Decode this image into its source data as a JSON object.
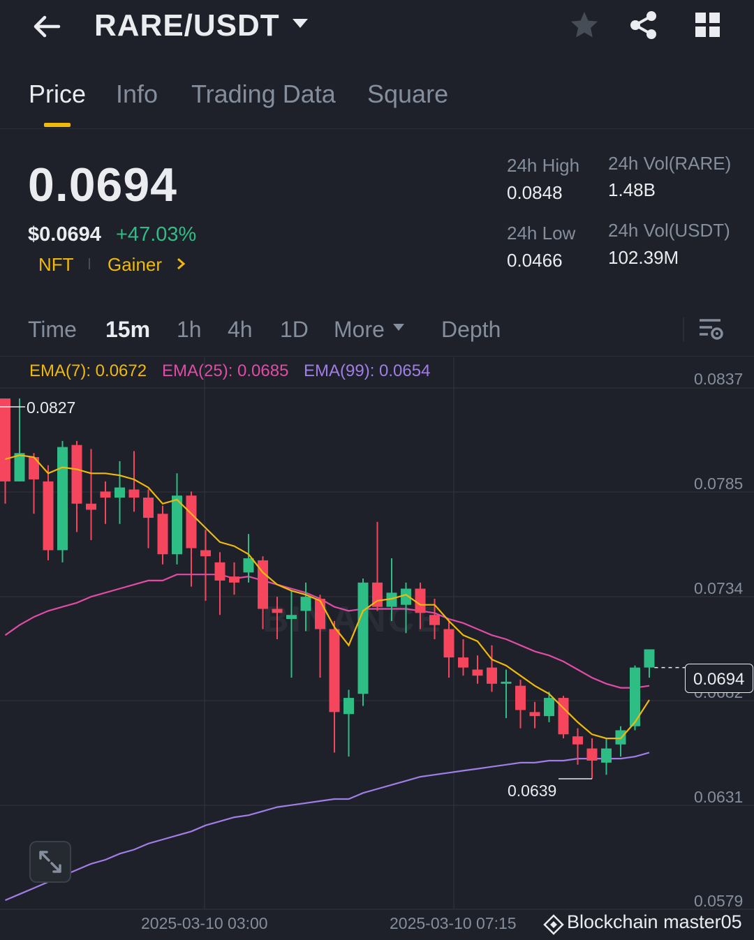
{
  "header": {
    "pair": "RARE/USDT"
  },
  "tabs": [
    {
      "label": "Price",
      "active": true
    },
    {
      "label": "Info",
      "active": false
    },
    {
      "label": "Trading Data",
      "active": false
    },
    {
      "label": "Square",
      "active": false
    }
  ],
  "ticker": {
    "price": "0.0694",
    "usd_price": "$0.0694",
    "change": "+47.03%",
    "tag_category": "NFT",
    "tag_gainer": "Gainer"
  },
  "stats": {
    "high_label": "24h High",
    "high_value": "0.0848",
    "low_label": "24h Low",
    "low_value": "0.0466",
    "vol_base_label": "24h Vol(RARE)",
    "vol_base_value": "1.48B",
    "vol_quote_label": "24h Vol(USDT)",
    "vol_quote_value": "102.39M"
  },
  "intervals": {
    "time": "Time",
    "m15": "15m",
    "h1": "1h",
    "h4": "4h",
    "d1": "1D",
    "more": "More",
    "depth": "Depth",
    "active": "15m"
  },
  "indicators": {
    "ema7": "EMA(7): 0.0672",
    "ema25": "EMA(25): 0.0685",
    "ema99": "EMA(99): 0.0654"
  },
  "colors": {
    "up": "#2ebd85",
    "down": "#f6465d",
    "ema7": "#f0b90b",
    "ema25": "#e04ca6",
    "ema99": "#a07ee6"
  },
  "chart": {
    "watermark": "BINANCE",
    "price_axis": [
      "0.0837",
      "0.0785",
      "0.0734",
      "0.0682",
      "0.0631",
      "0.0579"
    ],
    "time_axis": [
      "2025-03-10 03:00",
      "2025-03-10 07:15"
    ],
    "high_marker": "0.0827",
    "low_marker": "0.0639",
    "last_price": "0.0694",
    "expand_label": "expand"
  },
  "chart_data": {
    "type": "candlestick",
    "interval": "15m",
    "ylim": [
      0.0579,
      0.0837
    ],
    "x_ticks": [
      "2025-03-10 03:00",
      "2025-03-10 07:15"
    ],
    "candles": [
      {
        "o": 0.0827,
        "h": 0.0827,
        "l": 0.0775,
        "c": 0.0786
      },
      {
        "o": 0.0786,
        "h": 0.0827,
        "l": 0.0786,
        "c": 0.08
      },
      {
        "o": 0.0798,
        "h": 0.08,
        "l": 0.077,
        "c": 0.0787
      },
      {
        "o": 0.0786,
        "h": 0.0794,
        "l": 0.0747,
        "c": 0.0752
      },
      {
        "o": 0.0752,
        "h": 0.0806,
        "l": 0.0746,
        "c": 0.0803
      },
      {
        "o": 0.0804,
        "h": 0.0806,
        "l": 0.0761,
        "c": 0.0775
      },
      {
        "o": 0.0775,
        "h": 0.0802,
        "l": 0.0757,
        "c": 0.0772
      },
      {
        "o": 0.0781,
        "h": 0.0786,
        "l": 0.0765,
        "c": 0.0778
      },
      {
        "o": 0.0778,
        "h": 0.0796,
        "l": 0.0765,
        "c": 0.0783
      },
      {
        "o": 0.0782,
        "h": 0.0801,
        "l": 0.0771,
        "c": 0.0778
      },
      {
        "o": 0.0778,
        "h": 0.0782,
        "l": 0.0753,
        "c": 0.0768
      },
      {
        "o": 0.077,
        "h": 0.0774,
        "l": 0.0745,
        "c": 0.075
      },
      {
        "o": 0.075,
        "h": 0.079,
        "l": 0.0745,
        "c": 0.0779
      },
      {
        "o": 0.0779,
        "h": 0.0781,
        "l": 0.0734,
        "c": 0.0753
      },
      {
        "o": 0.0752,
        "h": 0.0762,
        "l": 0.0727,
        "c": 0.0749
      },
      {
        "o": 0.0746,
        "h": 0.0751,
        "l": 0.072,
        "c": 0.0737
      },
      {
        "o": 0.0739,
        "h": 0.0746,
        "l": 0.073,
        "c": 0.0736
      },
      {
        "o": 0.0741,
        "h": 0.076,
        "l": 0.0736,
        "c": 0.0748
      },
      {
        "o": 0.0747,
        "h": 0.0749,
        "l": 0.0713,
        "c": 0.0723
      },
      {
        "o": 0.0723,
        "h": 0.0729,
        "l": 0.0708,
        "c": 0.0721
      },
      {
        "o": 0.0718,
        "h": 0.0732,
        "l": 0.0689,
        "c": 0.072
      },
      {
        "o": 0.0722,
        "h": 0.0736,
        "l": 0.0712,
        "c": 0.0729
      },
      {
        "o": 0.0728,
        "h": 0.073,
        "l": 0.0689,
        "c": 0.0713
      },
      {
        "o": 0.0713,
        "h": 0.0717,
        "l": 0.0652,
        "c": 0.0672
      },
      {
        "o": 0.0671,
        "h": 0.0683,
        "l": 0.065,
        "c": 0.0679
      },
      {
        "o": 0.0681,
        "h": 0.0738,
        "l": 0.0675,
        "c": 0.0736
      },
      {
        "o": 0.0736,
        "h": 0.0766,
        "l": 0.0722,
        "c": 0.0724
      },
      {
        "o": 0.0724,
        "h": 0.0748,
        "l": 0.0717,
        "c": 0.0731
      },
      {
        "o": 0.0725,
        "h": 0.0736,
        "l": 0.0711,
        "c": 0.0733
      },
      {
        "o": 0.0733,
        "h": 0.0736,
        "l": 0.0713,
        "c": 0.0721
      },
      {
        "o": 0.072,
        "h": 0.0728,
        "l": 0.0708,
        "c": 0.0715
      },
      {
        "o": 0.0713,
        "h": 0.0717,
        "l": 0.0689,
        "c": 0.0699
      },
      {
        "o": 0.0699,
        "h": 0.0708,
        "l": 0.069,
        "c": 0.0694
      },
      {
        "o": 0.0693,
        "h": 0.07,
        "l": 0.0686,
        "c": 0.069
      },
      {
        "o": 0.0694,
        "h": 0.0705,
        "l": 0.0682,
        "c": 0.0686
      },
      {
        "o": 0.0686,
        "h": 0.0693,
        "l": 0.0669,
        "c": 0.0687
      },
      {
        "o": 0.0685,
        "h": 0.0688,
        "l": 0.0664,
        "c": 0.0673
      },
      {
        "o": 0.0672,
        "h": 0.0677,
        "l": 0.0664,
        "c": 0.067
      },
      {
        "o": 0.067,
        "h": 0.0682,
        "l": 0.0667,
        "c": 0.0679
      },
      {
        "o": 0.0679,
        "h": 0.068,
        "l": 0.0659,
        "c": 0.0661
      },
      {
        "o": 0.066,
        "h": 0.0664,
        "l": 0.0646,
        "c": 0.0656
      },
      {
        "o": 0.0654,
        "h": 0.0659,
        "l": 0.0639,
        "c": 0.0648
      },
      {
        "o": 0.0647,
        "h": 0.0659,
        "l": 0.0641,
        "c": 0.0654
      },
      {
        "o": 0.0656,
        "h": 0.0665,
        "l": 0.065,
        "c": 0.0663
      },
      {
        "o": 0.0665,
        "h": 0.0695,
        "l": 0.0663,
        "c": 0.0694
      },
      {
        "o": 0.0694,
        "h": 0.0703,
        "l": 0.0689,
        "c": 0.0703
      }
    ],
    "ema7": [
      0.0797,
      0.0799,
      0.0798,
      0.079,
      0.0793,
      0.0792,
      0.079,
      0.079,
      0.0789,
      0.0787,
      0.0783,
      0.0775,
      0.0777,
      0.077,
      0.0763,
      0.0756,
      0.0754,
      0.075,
      0.0741,
      0.0735,
      0.0732,
      0.073,
      0.0727,
      0.0714,
      0.0705,
      0.0722,
      0.0727,
      0.0728,
      0.073,
      0.0725,
      0.0725,
      0.0717,
      0.071,
      0.0707,
      0.0698,
      0.0695,
      0.069,
      0.0685,
      0.0681,
      0.0674,
      0.0667,
      0.0661,
      0.0659,
      0.0659,
      0.0667,
      0.0678
    ],
    "ema25": [
      0.071,
      0.0715,
      0.0719,
      0.0722,
      0.0724,
      0.0726,
      0.0729,
      0.0731,
      0.0733,
      0.0735,
      0.0737,
      0.0737,
      0.074,
      0.074,
      0.074,
      0.074,
      0.0738,
      0.0739,
      0.0737,
      0.0735,
      0.0733,
      0.0731,
      0.0728,
      0.0724,
      0.0722,
      0.0723,
      0.0723,
      0.0723,
      0.0723,
      0.0722,
      0.0721,
      0.0718,
      0.0716,
      0.0713,
      0.071,
      0.0708,
      0.0705,
      0.0702,
      0.07,
      0.0697,
      0.0693,
      0.0689,
      0.0686,
      0.0684,
      0.0684,
      0.0685
    ],
    "ema99": [
      0.0579,
      0.0582,
      0.0585,
      0.0588,
      0.0591,
      0.0594,
      0.0597,
      0.0599,
      0.0602,
      0.0604,
      0.0607,
      0.0609,
      0.0611,
      0.0613,
      0.0616,
      0.0618,
      0.062,
      0.0621,
      0.0623,
      0.0625,
      0.0626,
      0.0627,
      0.0628,
      0.0629,
      0.0629,
      0.0632,
      0.0634,
      0.0636,
      0.0638,
      0.064,
      0.0641,
      0.0642,
      0.0643,
      0.0644,
      0.0645,
      0.0646,
      0.0647,
      0.0647,
      0.0648,
      0.0648,
      0.0649,
      0.0649,
      0.0649,
      0.0649,
      0.065,
      0.0652
    ]
  },
  "footer": {
    "credit": "Blockchain master05"
  }
}
